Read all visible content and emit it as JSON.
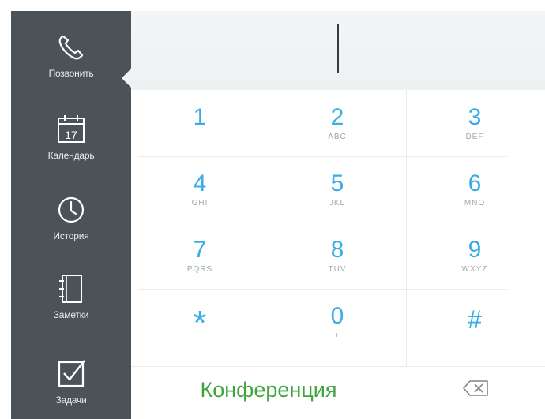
{
  "sidebar": {
    "items": [
      {
        "label": "Позвонить",
        "icon": "phone-icon"
      },
      {
        "label": "Календарь",
        "icon": "calendar-icon",
        "badge": "17"
      },
      {
        "label": "История",
        "icon": "clock-icon"
      },
      {
        "label": "Заметки",
        "icon": "notebook-icon"
      },
      {
        "label": "Задачи",
        "icon": "checkbox-icon"
      }
    ]
  },
  "display": {
    "value": ""
  },
  "keypad": {
    "keys": [
      {
        "digit": "1",
        "letters": ""
      },
      {
        "digit": "2",
        "letters": "ABC"
      },
      {
        "digit": "3",
        "letters": "DEF"
      },
      {
        "digit": "4",
        "letters": "GHI"
      },
      {
        "digit": "5",
        "letters": "JKL"
      },
      {
        "digit": "6",
        "letters": "MNO"
      },
      {
        "digit": "7",
        "letters": "PQRS"
      },
      {
        "digit": "8",
        "letters": "TUV"
      },
      {
        "digit": "9",
        "letters": "WXYZ"
      },
      {
        "digit": "*",
        "letters": ""
      },
      {
        "digit": "0",
        "letters": "+"
      },
      {
        "digit": "#",
        "letters": ""
      }
    ]
  },
  "actions": {
    "conference_label": "Конференция",
    "backspace_icon": "backspace-icon"
  },
  "colors": {
    "sidebar": "#4c5358",
    "digit": "#3aaee4",
    "conference": "#3fa53f"
  }
}
